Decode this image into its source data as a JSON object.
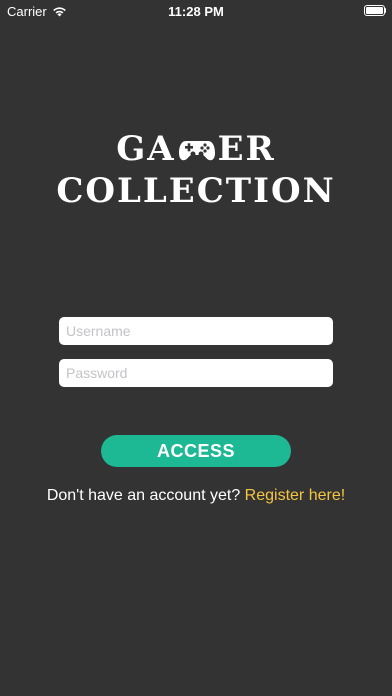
{
  "status_bar": {
    "carrier": "Carrier",
    "time": "11:28 PM"
  },
  "logo": {
    "line1_left": "GA",
    "line1_right": "ER",
    "line2": "COLLECTION"
  },
  "form": {
    "username_placeholder": "Username",
    "password_placeholder": "Password",
    "access_label": "ACCESS",
    "register_prompt": "Don't have an account yet?",
    "register_link": "Register here!"
  },
  "colors": {
    "background": "#333333",
    "accent": "#1db894",
    "link": "#f5c542"
  }
}
